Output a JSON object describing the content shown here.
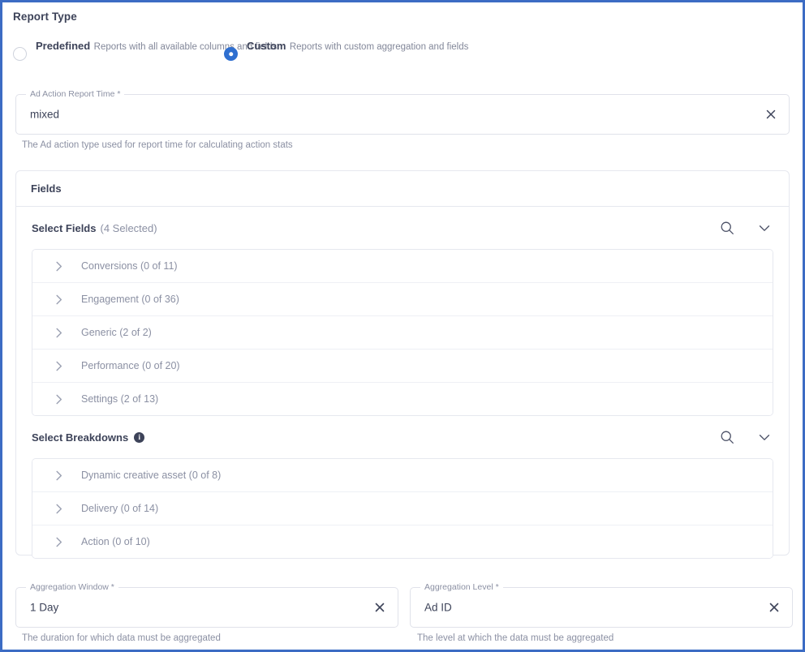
{
  "report_type": {
    "title": "Report Type",
    "options": [
      {
        "label": "Predefined",
        "description": "Reports with all available columns and fields",
        "selected": false
      },
      {
        "label": "Custom",
        "description": "Reports with custom aggregation and fields",
        "selected": true
      }
    ]
  },
  "ad_action_report_time": {
    "label": "Ad Action Report Time *",
    "value": "mixed",
    "helper": "The Ad action type used for report time for calculating action stats",
    "clear_icon": "close-icon"
  },
  "fields_card": {
    "header": "Fields",
    "select_fields": {
      "label": "Select Fields",
      "count": "(4 Selected)",
      "search_icon": "search-icon",
      "collapse_icon": "chevron-down-icon",
      "rows": [
        {
          "label": "Conversions (0 of 11)"
        },
        {
          "label": "Engagement (0 of 36)"
        },
        {
          "label": "Generic (2 of 2)"
        },
        {
          "label": "Performance (0 of 20)"
        },
        {
          "label": "Settings (2 of 13)"
        }
      ]
    },
    "select_breakdowns": {
      "label": "Select Breakdowns",
      "info_icon": "info-icon",
      "info_glyph": "i",
      "search_icon": "search-icon",
      "collapse_icon": "chevron-down-icon",
      "rows": [
        {
          "label": "Dynamic creative asset (0 of 8)"
        },
        {
          "label": "Delivery (0 of 14)"
        },
        {
          "label": "Action (0 of 10)"
        }
      ]
    }
  },
  "aggregation_window": {
    "label": "Aggregation Window *",
    "value": "1 Day",
    "helper": "The duration for which data must be aggregated",
    "clear_icon": "close-icon"
  },
  "aggregation_level": {
    "label": "Aggregation Level *",
    "value": "Ad ID",
    "helper": "The level at which the data must be aggregated",
    "clear_icon": "close-icon"
  },
  "colors": {
    "accent": "#2f6fd0",
    "frame_border": "#3c6cc4",
    "text_primary": "#3d4359",
    "text_muted": "#8b90a3"
  }
}
